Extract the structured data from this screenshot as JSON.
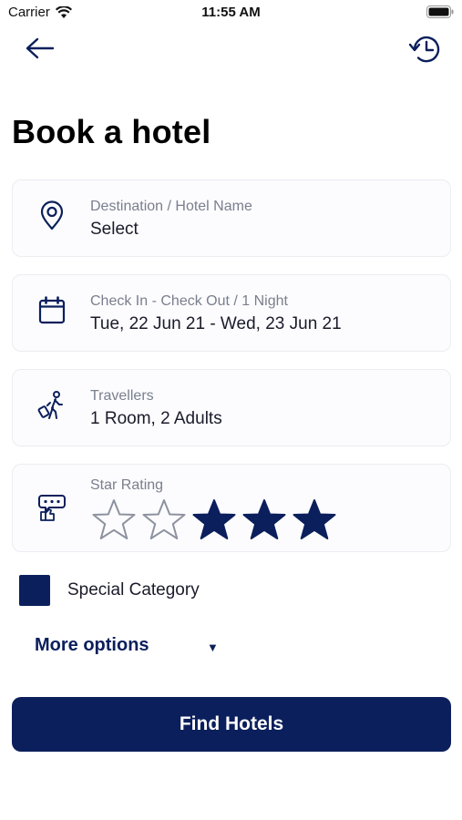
{
  "status_bar": {
    "carrier": "Carrier",
    "time": "11:55 AM"
  },
  "page": {
    "title": "Book a hotel"
  },
  "destination": {
    "label": "Destination / Hotel Name",
    "value": "Select"
  },
  "dates": {
    "label": "Check In - Check Out / 1 Night",
    "value": "Tue, 22 Jun 21 - Wed, 23 Jun 21"
  },
  "travellers": {
    "label": "Travellers",
    "value": "1 Room, 2 Adults"
  },
  "star_rating": {
    "label": "Star Rating",
    "stars": [
      {
        "icon": "star-outline-icon",
        "filled": false
      },
      {
        "icon": "star-outline-icon",
        "filled": false
      },
      {
        "icon": "star-filled-icon",
        "filled": true
      },
      {
        "icon": "star-filled-icon",
        "filled": true
      },
      {
        "icon": "star-filled-icon",
        "filled": true
      }
    ]
  },
  "special_category": {
    "label": "Special Category",
    "checked": true
  },
  "more_options": {
    "label": "More options",
    "caret": "▼"
  },
  "find_button": {
    "label": "Find Hotels"
  },
  "colors": {
    "primary": "#0b1f5c",
    "card_border": "#ececf2",
    "label": "#7a7f8e"
  }
}
